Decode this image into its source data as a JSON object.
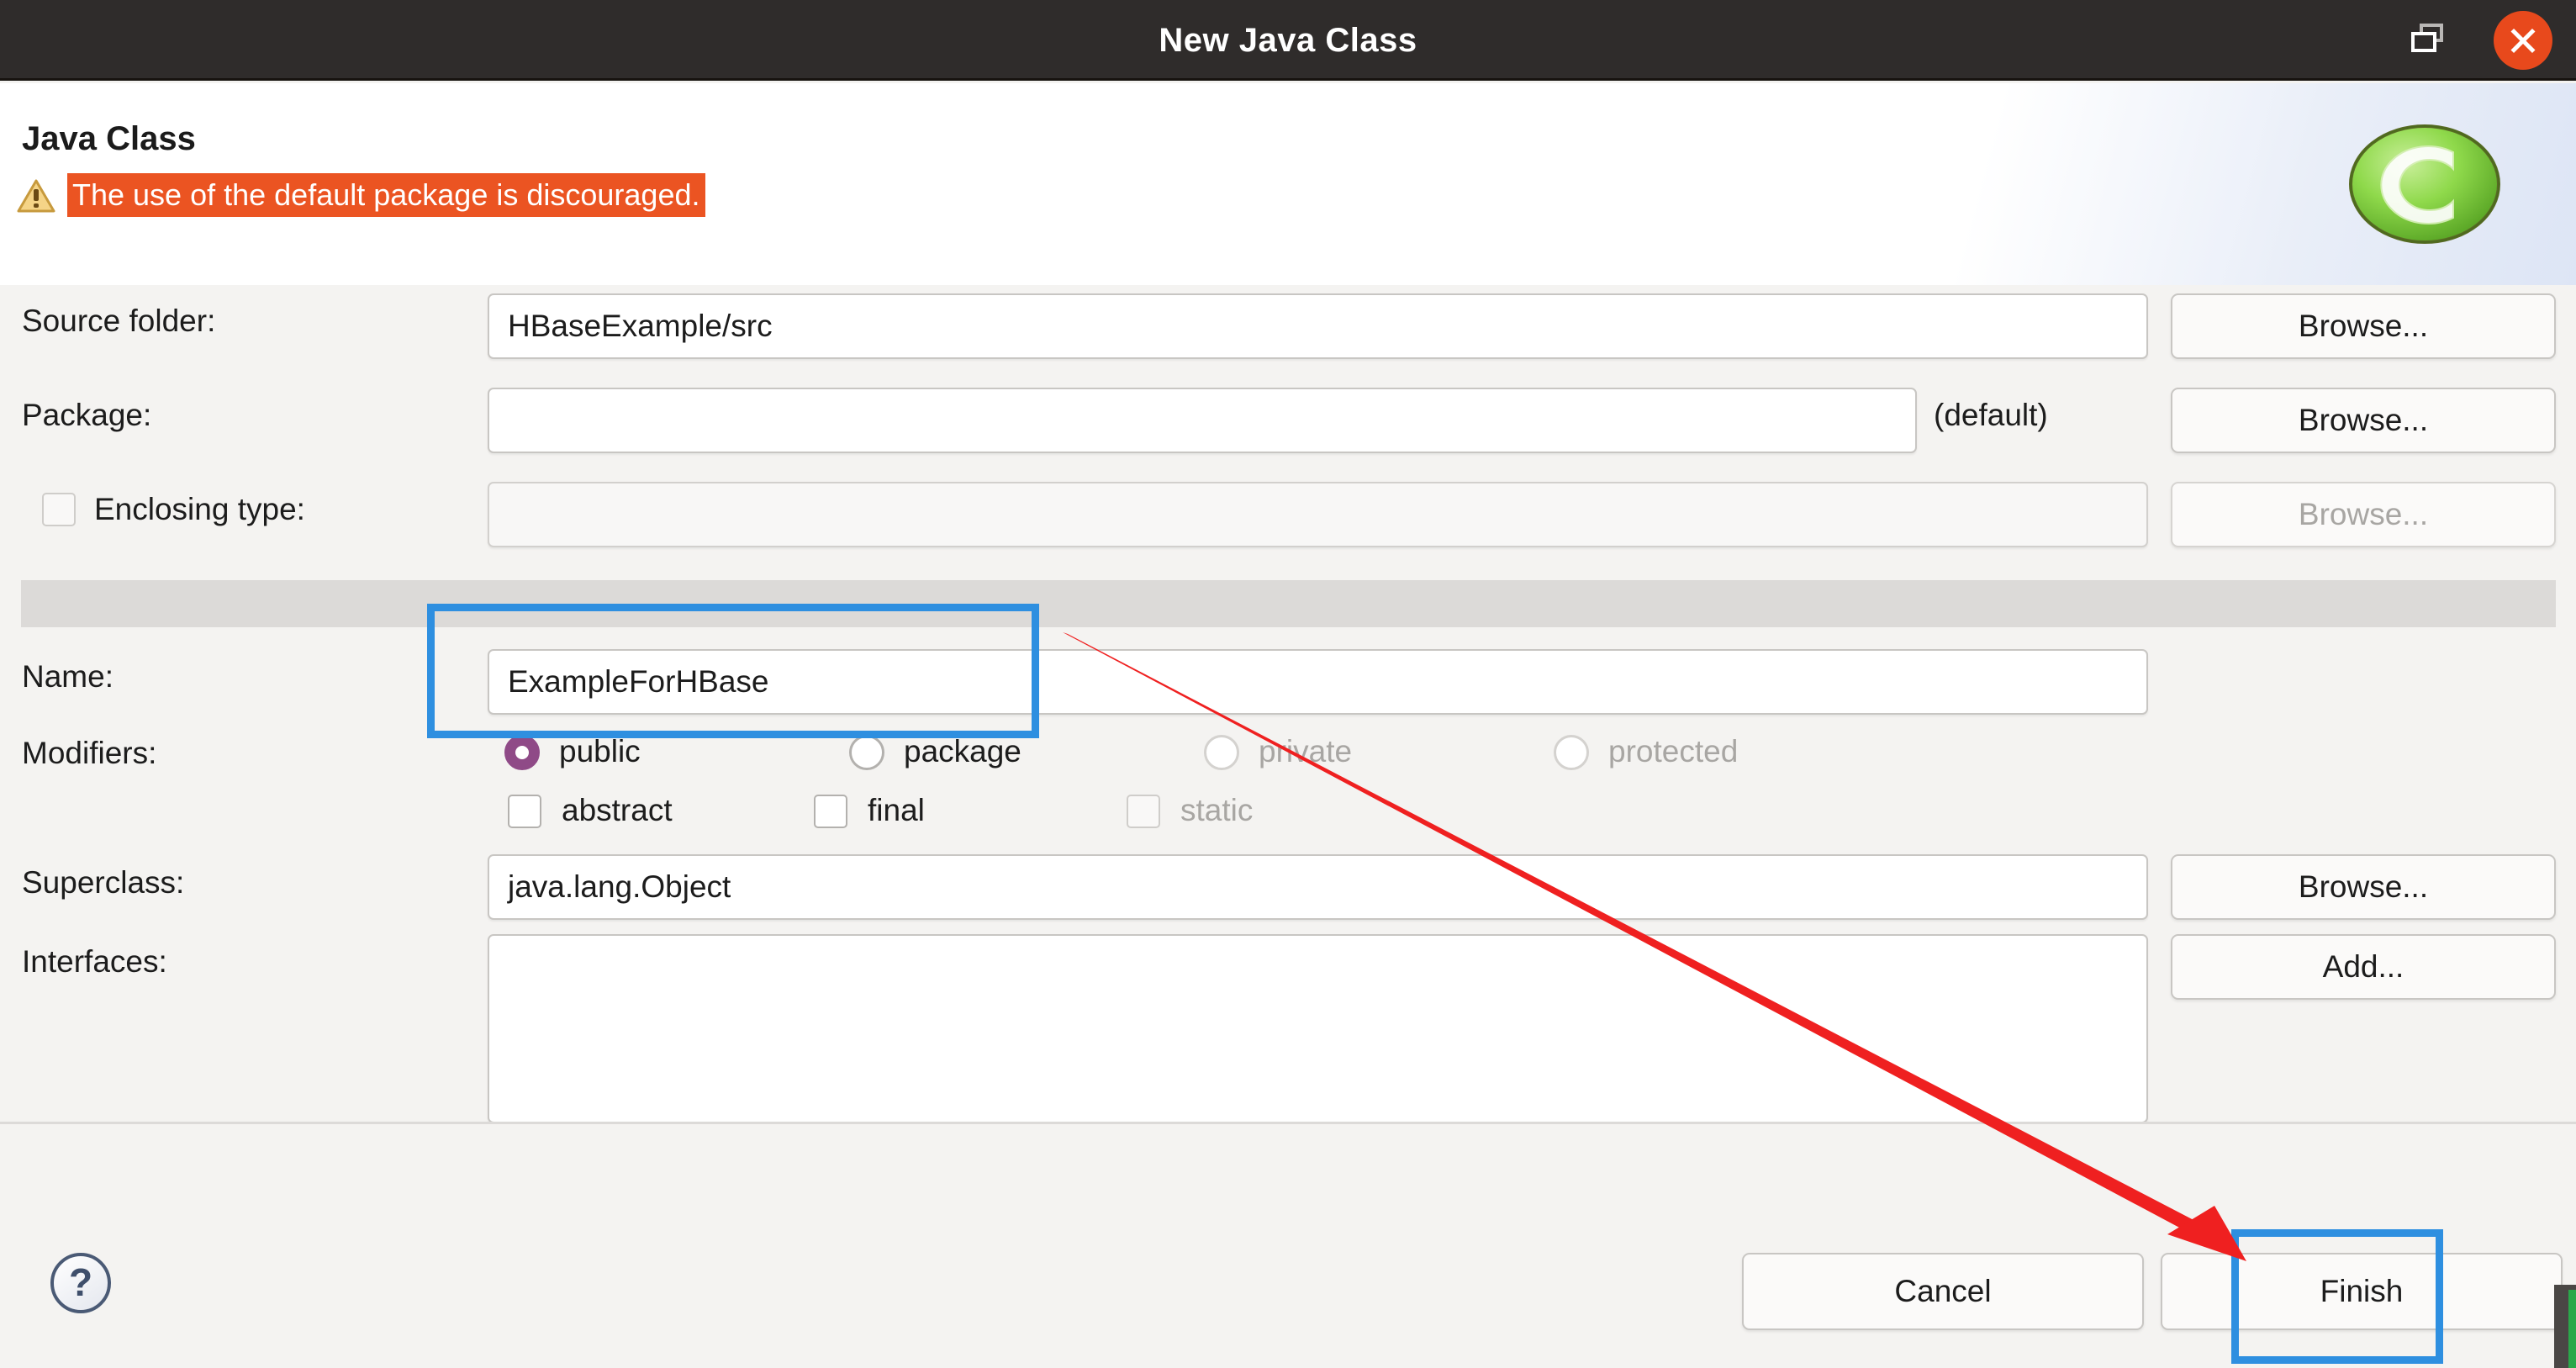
{
  "window": {
    "title": "New Java Class",
    "restore_icon": "restore-window-icon",
    "close_icon": "close-icon"
  },
  "header": {
    "title": "Java Class",
    "warning_icon": "warning-triangle-icon",
    "warning_text": "The use of the default package is discouraged.",
    "logo": "eclipse-logo"
  },
  "form": {
    "source_folder": {
      "label": "Source folder:",
      "value": "HBaseExample/src",
      "browse_label": "Browse..."
    },
    "package": {
      "label": "Package:",
      "value": "",
      "hint": "(default)",
      "browse_label": "Browse..."
    },
    "enclosing_type": {
      "label": "Enclosing type:",
      "value": "",
      "checked": false,
      "browse_label": "Browse...",
      "disabled": true
    },
    "name": {
      "label": "Name:",
      "value": "ExampleForHBase"
    },
    "modifiers": {
      "label": "Modifiers:",
      "radios": [
        {
          "label": "public",
          "checked": true,
          "disabled": false
        },
        {
          "label": "package",
          "checked": false,
          "disabled": false
        },
        {
          "label": "private",
          "checked": false,
          "disabled": true
        },
        {
          "label": "protected",
          "checked": false,
          "disabled": true
        }
      ],
      "checkboxes": [
        {
          "label": "abstract",
          "checked": false,
          "disabled": false
        },
        {
          "label": "final",
          "checked": false,
          "disabled": false
        },
        {
          "label": "static",
          "checked": false,
          "disabled": true
        }
      ]
    },
    "superclass": {
      "label": "Superclass:",
      "value": "java.lang.Object",
      "browse_label": "Browse..."
    },
    "interfaces": {
      "label": "Interfaces:",
      "value": "",
      "add_label": "Add..."
    }
  },
  "footer": {
    "help_label": "?",
    "cancel_label": "Cancel",
    "finish_label": "Finish"
  },
  "annotations": {
    "highlight_color": "#2e8fe0",
    "arrow_color": "#ef2020",
    "highlighted": [
      "name-field",
      "finish-button"
    ]
  },
  "colors": {
    "titlebar_bg": "#2f2c2b",
    "close_btn": "#e8491c",
    "warning_bg": "#eb5422",
    "radio_selected": "#8f4a87",
    "body_bg": "#f4f3f1",
    "separator_band": "#dcdad8"
  }
}
